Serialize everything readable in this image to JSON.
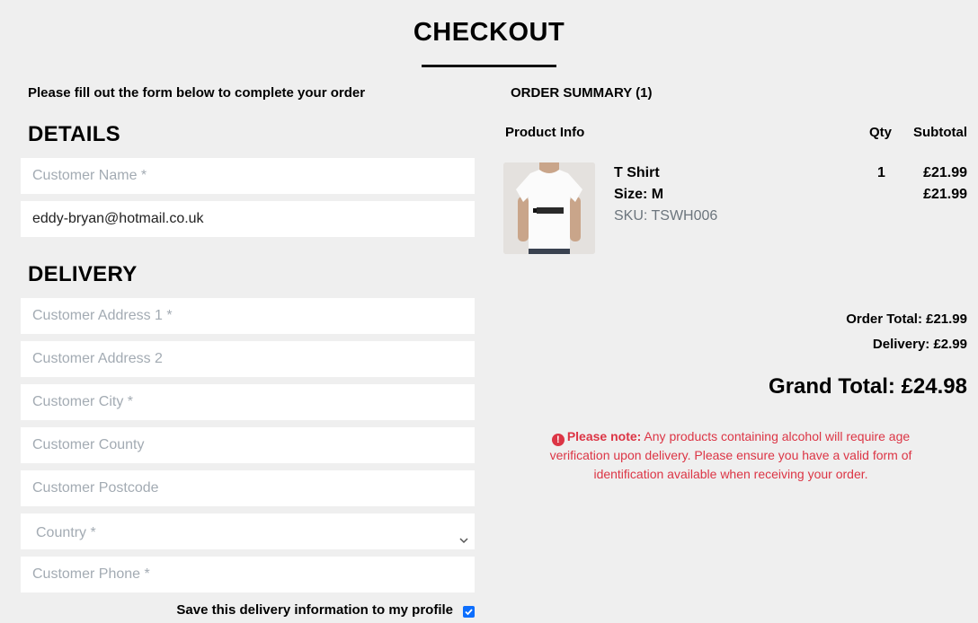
{
  "page": {
    "title": "CHECKOUT",
    "instructions": "Please fill out the form below to complete your order"
  },
  "details": {
    "heading": "DETAILS",
    "name_placeholder": "Customer Name *",
    "email_value": "eddy-bryan@hotmail.co.uk"
  },
  "delivery": {
    "heading": "DELIVERY",
    "address1_placeholder": "Customer Address 1 *",
    "address2_placeholder": "Customer Address 2",
    "city_placeholder": "Customer City *",
    "county_placeholder": "Customer County",
    "postcode_placeholder": "Customer Postcode",
    "country_selected": "Country *",
    "phone_placeholder": "Customer Phone *",
    "save_label": "Save this delivery information to my profile",
    "save_checked": true
  },
  "summary": {
    "heading": "ORDER SUMMARY (1)",
    "col_product": "Product Info",
    "col_qty": "Qty",
    "col_subtotal": "Subtotal",
    "items": [
      {
        "name": "T Shirt",
        "size": "Size: M",
        "sku": "SKU: TSWH006",
        "qty": "1",
        "price": "£21.99",
        "subtotal": "£21.99",
        "image_icon": "t-shirt-product-photo"
      }
    ],
    "order_total": "Order Total: £21.99",
    "delivery": "Delivery: £2.99",
    "grand_total": "Grand Total: £24.98"
  },
  "note": {
    "icon": "exclamation-circle-icon",
    "label": "Please note:",
    "text": " Any products containing alcohol will require age verification upon delivery. Please ensure you have a valid form of identification available when receiving your order."
  },
  "colors": {
    "background": "#efefef",
    "warning": "#dc3545",
    "checkbox": "#0d6efd",
    "placeholder": "#a3abb3",
    "muted": "#6c757d"
  }
}
